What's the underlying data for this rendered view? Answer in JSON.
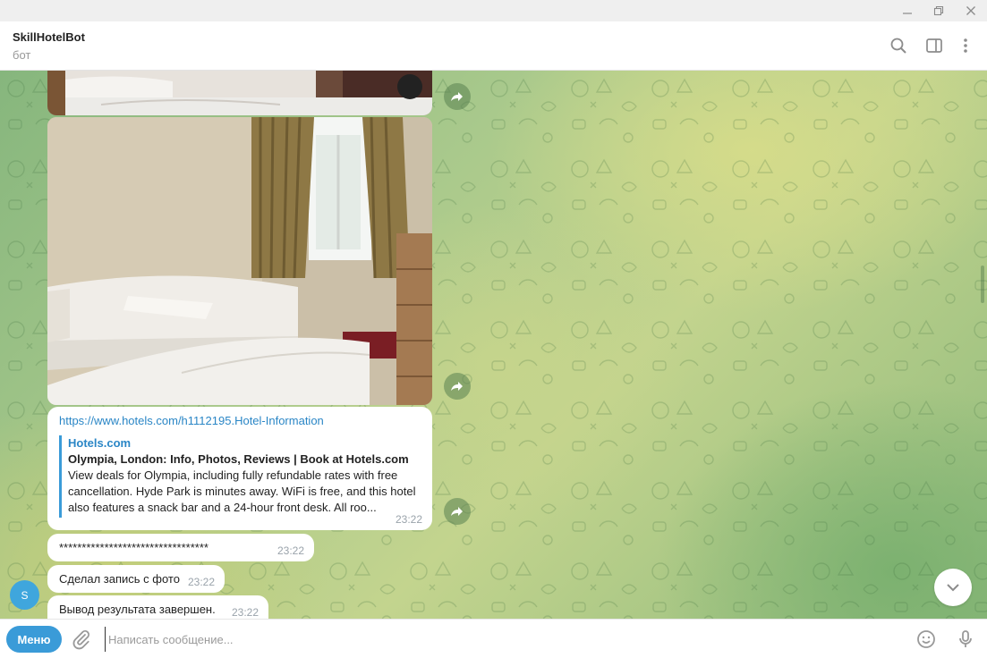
{
  "window": {
    "minimize_icon": "minimize-icon",
    "restore_icon": "restore-icon",
    "close_icon": "close-icon"
  },
  "header": {
    "title": "SkillHotelBot",
    "subtitle": "бот",
    "icons": [
      "search-icon",
      "side-panel-icon",
      "more-vertical-icon"
    ]
  },
  "messages": {
    "link": {
      "url": "https://www.hotels.com/h1112195.Hotel-Information",
      "preview_site": "Hotels.com",
      "preview_title": "Olympia, London: Info, Photos, Reviews | Book at Hotels.com",
      "preview_desc": "View deals for Olympia, including fully refundable rates with free cancellation. Hyde Park is minutes away. WiFi is free, and this hotel also features a snack bar and a 24-hour front desk. All roo...",
      "time": "23:22"
    },
    "stars": {
      "text": "*********************************",
      "time": "23:22"
    },
    "photo_done": {
      "text": "Сделал запись с фото",
      "time": "23:22"
    },
    "output_done": {
      "text": "Вывод результата завершен.",
      "time": "23:22"
    }
  },
  "avatar": {
    "letter": "S"
  },
  "composer": {
    "menu_label": "Меню",
    "placeholder": "Написать сообщение...",
    "value": ""
  },
  "colors": {
    "accent": "#3a9bd8",
    "link": "#2a86c6",
    "bubble": "#ffffff"
  }
}
